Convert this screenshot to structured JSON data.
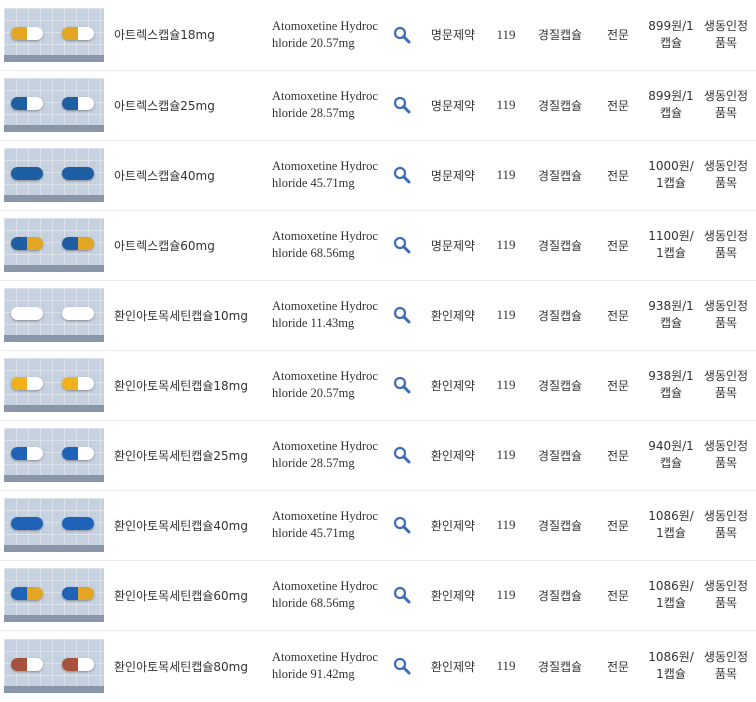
{
  "rows": [
    {
      "name": "아트렉스캡슐18mg",
      "ingredient": "Atomoxetine Hydrochloride 20.57mg",
      "maker": "명문제약",
      "code": "119",
      "form": "경질캡슐",
      "class": "전문",
      "price": "899원/1캡슐",
      "status": "생동인정품목",
      "cap_left": "#e2a623",
      "cap_right": "#ffffff"
    },
    {
      "name": "아트렉스캡슐25mg",
      "ingredient": "Atomoxetine Hydrochloride 28.57mg",
      "maker": "명문제약",
      "code": "119",
      "form": "경질캡슐",
      "class": "전문",
      "price": "899원/1캡슐",
      "status": "생동인정품목",
      "cap_left": "#1e5fa3",
      "cap_right": "#ffffff"
    },
    {
      "name": "아트렉스캡슐40mg",
      "ingredient": "Atomoxetine Hydrochloride 45.71mg",
      "maker": "명문제약",
      "code": "119",
      "form": "경질캡슐",
      "class": "전문",
      "price": "1000원/1캡슐",
      "status": "생동인정품목",
      "cap_left": "#1e5fa3",
      "cap_right": "#1e5fa3"
    },
    {
      "name": "아트렉스캡슐60mg",
      "ingredient": "Atomoxetine Hydrochloride 68.56mg",
      "maker": "명문제약",
      "code": "119",
      "form": "경질캡슐",
      "class": "전문",
      "price": "1100원/1캡슐",
      "status": "생동인정품목",
      "cap_left": "#1e5fa3",
      "cap_right": "#e2a623"
    },
    {
      "name": "환인아토목세틴캡슐10mg",
      "ingredient": "Atomoxetine Hydrochloride 11.43mg",
      "maker": "환인제약",
      "code": "119",
      "form": "경질캡슐",
      "class": "전문",
      "price": "938원/1캡슐",
      "status": "생동인정품목",
      "cap_left": "#ffffff",
      "cap_right": "#ffffff"
    },
    {
      "name": "환인아토목세틴캡슐18mg",
      "ingredient": "Atomoxetine Hydrochloride 20.57mg",
      "maker": "환인제약",
      "code": "119",
      "form": "경질캡슐",
      "class": "전문",
      "price": "938원/1캡슐",
      "status": "생동인정품목",
      "cap_left": "#f0b21a",
      "cap_right": "#ffffff"
    },
    {
      "name": "환인아토목세틴캡슐25mg",
      "ingredient": "Atomoxetine Hydrochloride 28.57mg",
      "maker": "환인제약",
      "code": "119",
      "form": "경질캡슐",
      "class": "전문",
      "price": "940원/1캡슐",
      "status": "생동인정품목",
      "cap_left": "#1f63b8",
      "cap_right": "#ffffff"
    },
    {
      "name": "환인아토목세틴캡슐40mg",
      "ingredient": "Atomoxetine Hydrochloride 45.71mg",
      "maker": "환인제약",
      "code": "119",
      "form": "경질캡슐",
      "class": "전문",
      "price": "1086원/1캡슐",
      "status": "생동인정품목",
      "cap_left": "#1f63b8",
      "cap_right": "#1f63b8"
    },
    {
      "name": "환인아토목세틴캡슐60mg",
      "ingredient": "Atomoxetine Hydrochloride 68.56mg",
      "maker": "환인제약",
      "code": "119",
      "form": "경질캡슐",
      "class": "전문",
      "price": "1086원/1캡슐",
      "status": "생동인정품목",
      "cap_left": "#1f63b8",
      "cap_right": "#e2a623"
    },
    {
      "name": "환인아토목세틴캡슐80mg",
      "ingredient": "Atomoxetine Hydrochloride 91.42mg",
      "maker": "환인제약",
      "code": "119",
      "form": "경질캡슐",
      "class": "전문",
      "price": "1086원/1캡슐",
      "status": "생동인정품목",
      "cap_left": "#a6523c",
      "cap_right": "#ffffff"
    }
  ],
  "search_icon": "magnifier-icon",
  "accent": "#3d6db5"
}
